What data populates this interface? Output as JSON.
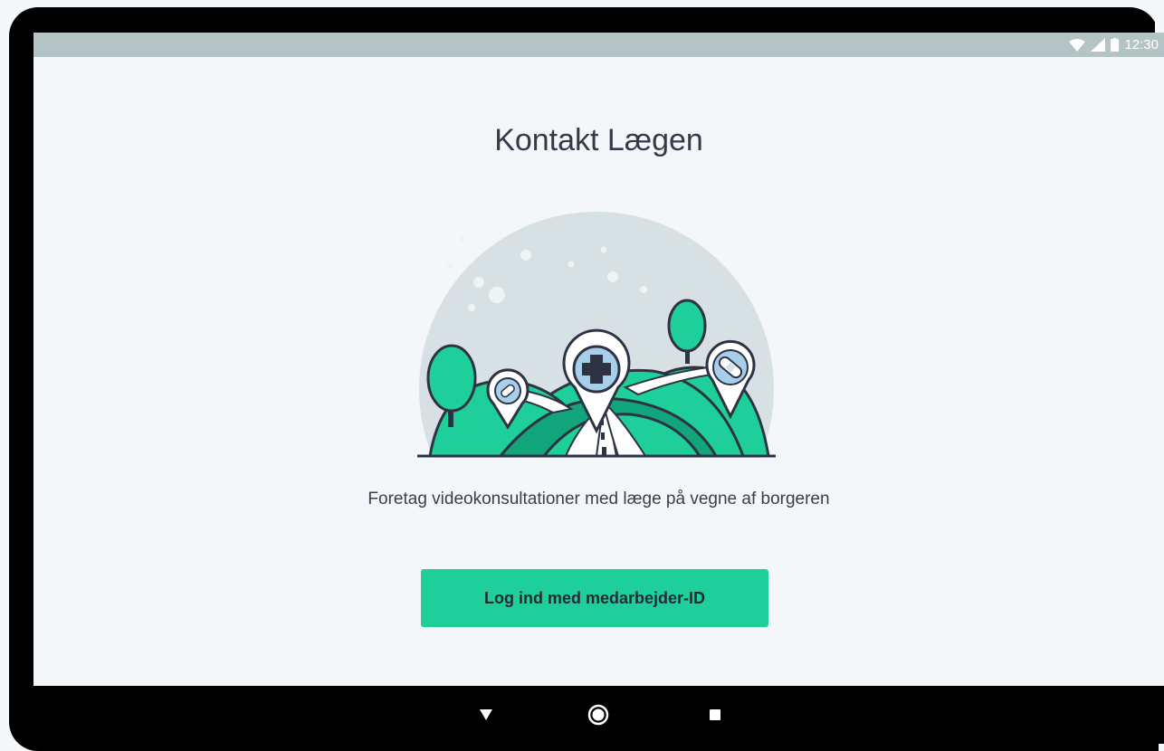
{
  "status_bar": {
    "time": "12:30",
    "icons": [
      "wifi-icon",
      "signal-icon",
      "battery-icon"
    ]
  },
  "page": {
    "title": "Kontakt Lægen",
    "description": "Foretag videokonsultationer med læge på vegne af borgeren"
  },
  "login_button": {
    "label": "Log ind med medarbejder-ID"
  },
  "nav_bar": {
    "buttons": [
      "back-icon",
      "home-icon",
      "recents-icon"
    ]
  },
  "colors": {
    "accent": "#1fcf9a",
    "status_bar": "#b4c3c4",
    "background": "#f3f7f9",
    "title_text": "#34394b",
    "hill_green": "#1fcf9a",
    "hill_dark": "#12a57c",
    "pin_blue": "#a8cfe9"
  }
}
